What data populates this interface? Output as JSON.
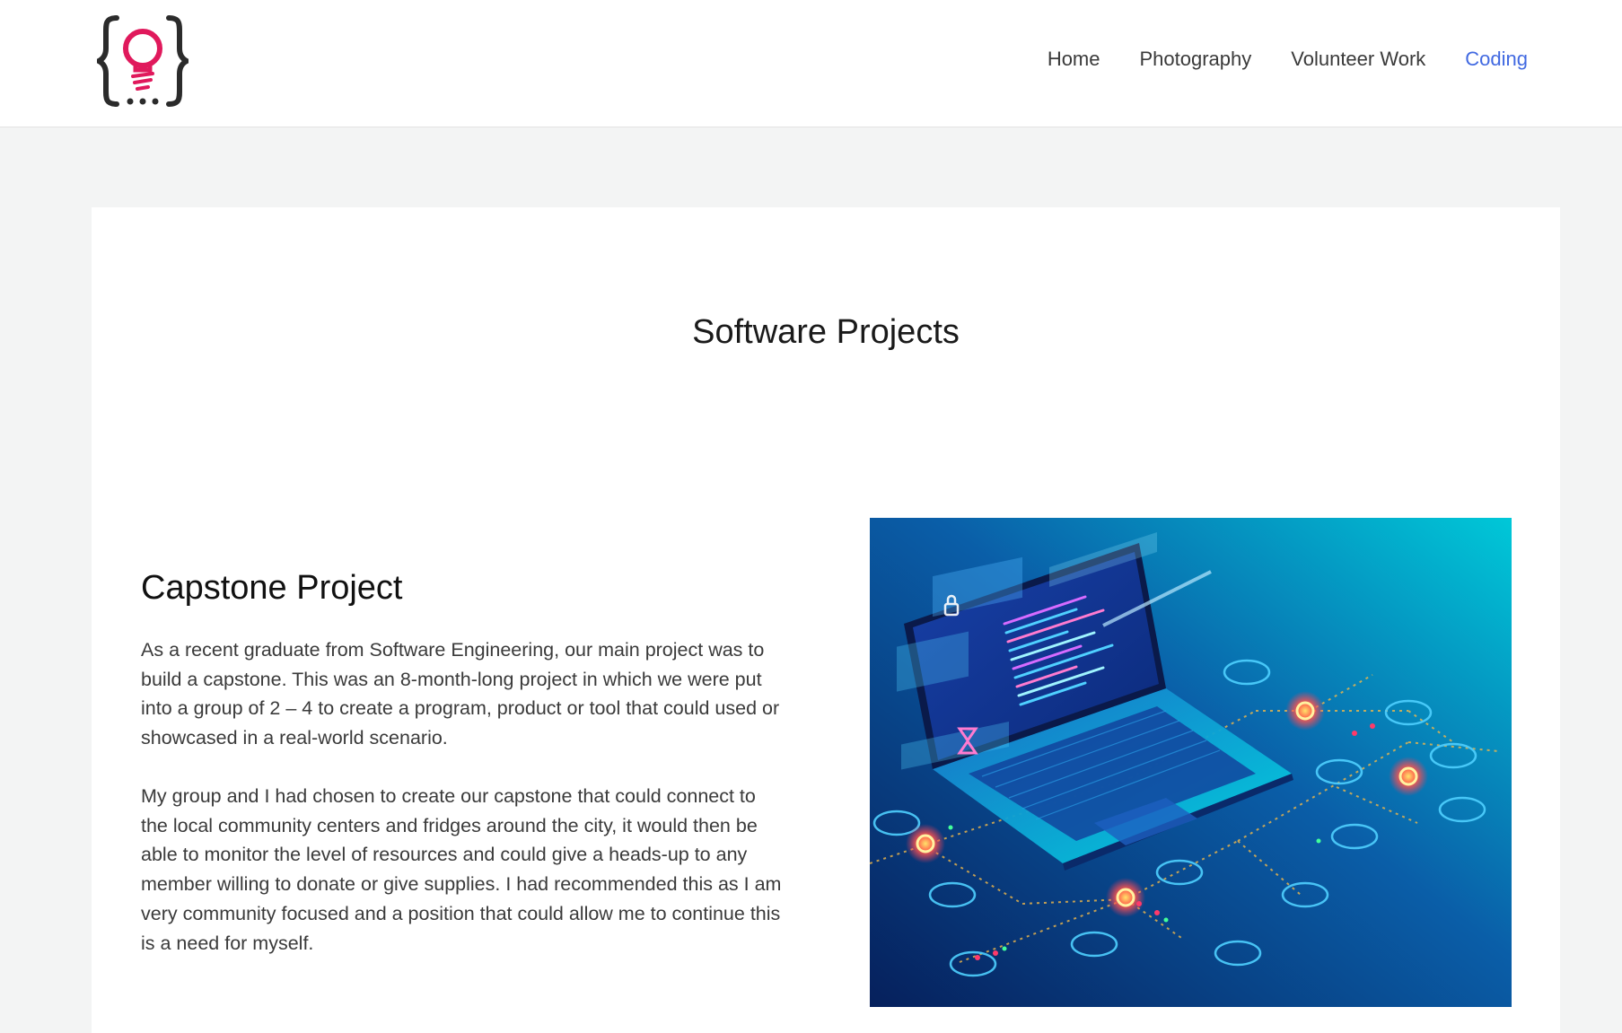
{
  "header": {
    "logo_icon": "lightbulb-braces-logo",
    "nav": [
      {
        "label": "Home",
        "active": false
      },
      {
        "label": "Photography",
        "active": false
      },
      {
        "label": "Volunteer Work",
        "active": false
      },
      {
        "label": "Coding",
        "active": true
      }
    ]
  },
  "main": {
    "page_title": "Software Projects",
    "section": {
      "title": "Capstone Project",
      "paragraphs": [
        "As a recent graduate from Software Engineering, our main project was to build a capstone. This was an 8-month-long project in which we were put into a group of 2 – 4 to create a program, product or tool that could used or showcased in a real-world scenario.",
        "My group and I had chosen to create our capstone that could connect to the local community centers and fridges around the city, it would then be able to monitor the level of resources and could give a heads-up to any member willing to donate or give supplies. I had recommended this as I am very community focused and a position that could allow me to continue this is a need for myself."
      ],
      "image_icon": "laptop-network-illustration"
    }
  },
  "colors": {
    "accent": "#4169e1",
    "logo_pink": "#e0195c",
    "logo_dark": "#2b2b2b",
    "background": "#f3f4f4"
  }
}
